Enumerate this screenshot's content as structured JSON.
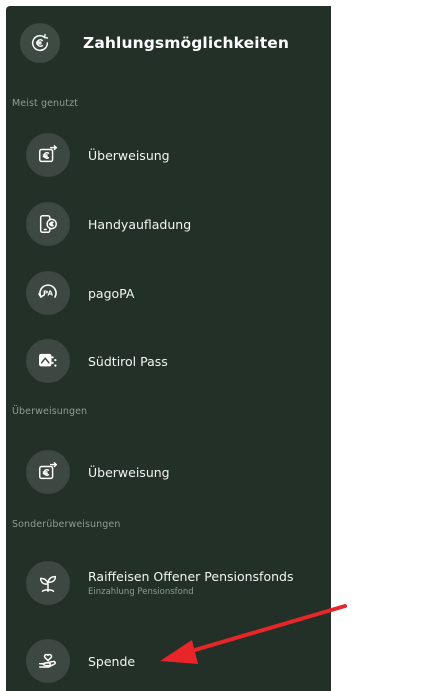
{
  "header": {
    "title": "Zahlungsmöglichkeiten",
    "icon": "euro-exchange-icon"
  },
  "sections": [
    {
      "label": "Meist genutzt",
      "items": [
        {
          "label": "Überweisung",
          "icon": "transfer-icon"
        },
        {
          "label": "Handyaufladung",
          "icon": "phone-topup-icon"
        },
        {
          "label": "pagoPA",
          "icon": "pagopa-icon"
        },
        {
          "label": "Südtirol Pass",
          "icon": "pass-card-icon"
        }
      ]
    },
    {
      "label": "Überweisungen",
      "items": [
        {
          "label": "Überweisung",
          "icon": "transfer-icon"
        }
      ]
    },
    {
      "label": "Sonderüberweisungen",
      "items": [
        {
          "label": "Raiffeisen Offener Pensionsfonds",
          "sublabel": "Einzahlung Pensionsfond",
          "icon": "plant-icon"
        },
        {
          "label": "Spende",
          "icon": "donation-heart-hand-icon"
        }
      ]
    }
  ],
  "annotation": {
    "type": "arrow",
    "color": "#e8262a",
    "points_to": "Spende"
  },
  "colors": {
    "background": "#223027",
    "icon_circle": "#3c4841",
    "text": "#f3f5f2",
    "muted_text": "#8f9b93",
    "arrow": "#e8262a"
  }
}
